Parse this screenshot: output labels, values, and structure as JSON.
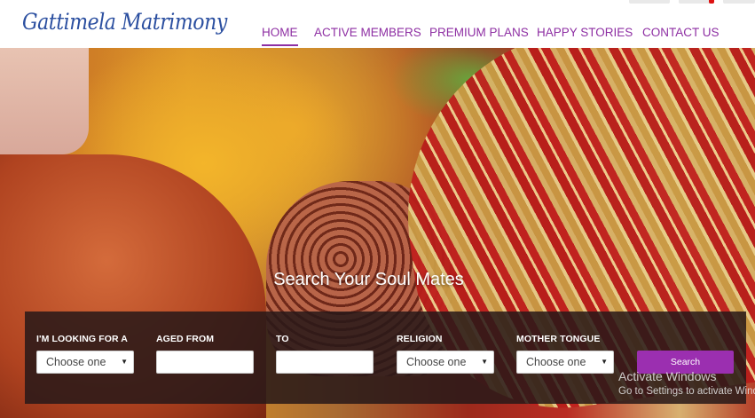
{
  "brand": {
    "logo_text": "Gattimela Matrimony",
    "accent_color": "#8e2fa3"
  },
  "nav": {
    "items": [
      {
        "label": "HOME",
        "active": true
      },
      {
        "label": "ACTIVE MEMBERS",
        "active": false
      },
      {
        "label": "PREMIUM PLANS",
        "active": false
      },
      {
        "label": "HAPPY STORIES",
        "active": false
      },
      {
        "label": "CONTACT US",
        "active": false
      }
    ]
  },
  "hero": {
    "title": "Search Your Soul Mates"
  },
  "search": {
    "fields": [
      {
        "label": "I'M LOOKING FOR A",
        "type": "select",
        "value": "Choose one"
      },
      {
        "label": "AGED FROM",
        "type": "text",
        "value": ""
      },
      {
        "label": "TO",
        "type": "text",
        "value": ""
      },
      {
        "label": "RELIGION",
        "type": "select",
        "value": "Choose one"
      },
      {
        "label": "MOTHER TONGUE",
        "type": "select",
        "value": "Choose one"
      }
    ],
    "button_label": "Search",
    "button_color": "#9b2fb0"
  },
  "watermark": {
    "line1": "Activate Windows",
    "line2": "Go to Settings to activate Wind"
  }
}
